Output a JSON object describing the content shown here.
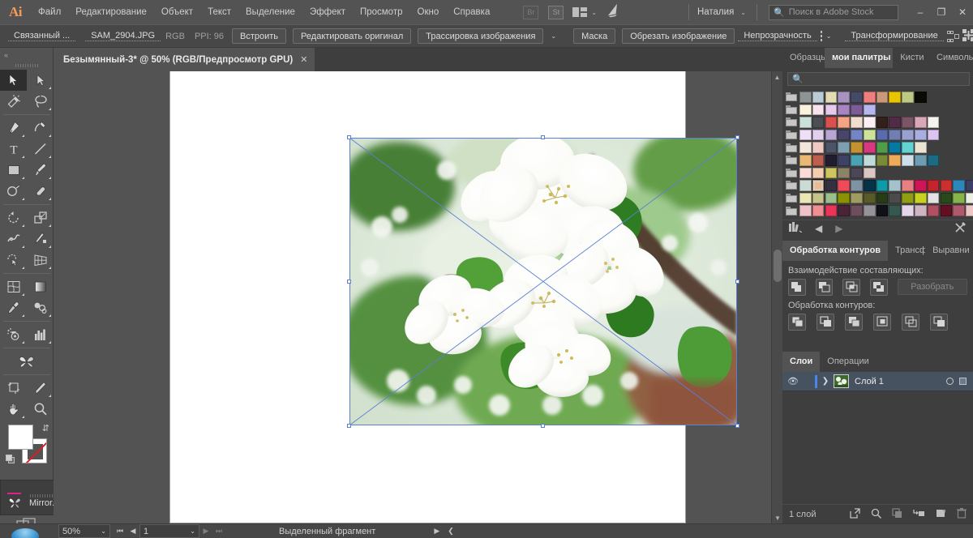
{
  "app": {
    "logo": "Ai",
    "title": "Adobe Illustrator"
  },
  "menu": {
    "items": [
      "Файл",
      "Редактирование",
      "Объект",
      "Текст",
      "Выделение",
      "Эффект",
      "Просмотр",
      "Окно",
      "Справка"
    ],
    "bridge_label": "Br",
    "stock_label": "St",
    "arrange_icon": "arrange-documents-icon",
    "boat_icon": "boat-icon",
    "user_name": "Наталия",
    "search_placeholder": "Поиск в Adobe Stock",
    "search_icon": "search-icon",
    "minimize": "–",
    "restore": "❐",
    "close": "✕"
  },
  "control_bar": {
    "link_status": "Связанный ...",
    "file_name": "SAM_2904.JPG",
    "color_mode": "RGB",
    "ppi": "PPI: 96",
    "embed": "Встроить",
    "edit_original": "Редактировать оригинал",
    "image_trace": "Трассировка изображения",
    "mask": "Маска",
    "crop_image": "Обрезать изображение",
    "opacity": "Непрозрачность",
    "transform": "Трансформирование",
    "align_icon": "align-icon",
    "distribute_icon": "distribute-icon",
    "menu_icon": "panel-menu-icon"
  },
  "document": {
    "tab_title": "Безымянный-3* @ 50% (RGB/Предпросмотр GPU)",
    "close_icon": "close-icon"
  },
  "toolbar": {
    "collapse_icon": "collapse-panel-icon",
    "tools": [
      {
        "name": "selection-tool",
        "selected": true
      },
      {
        "name": "direct-selection-tool",
        "selected": false
      },
      {
        "name": "magic-wand-tool",
        "selected": false
      },
      {
        "name": "lasso-tool",
        "selected": false
      },
      {
        "name": "pen-tool",
        "selected": false
      },
      {
        "name": "curvature-tool",
        "selected": false
      },
      {
        "name": "type-tool",
        "selected": false
      },
      {
        "name": "line-segment-tool",
        "selected": false
      },
      {
        "name": "rectangle-tool",
        "selected": false
      },
      {
        "name": "paintbrush-tool",
        "selected": false
      },
      {
        "name": "shaper-tool",
        "selected": false
      },
      {
        "name": "eraser-tool",
        "selected": false
      },
      {
        "name": "rotate-tool",
        "selected": false
      },
      {
        "name": "scale-tool",
        "selected": false
      },
      {
        "name": "width-tool",
        "selected": false
      },
      {
        "name": "free-transform-tool",
        "selected": false
      },
      {
        "name": "shape-builder-tool",
        "selected": false
      },
      {
        "name": "perspective-grid-tool",
        "selected": false
      },
      {
        "name": "mesh-tool",
        "selected": false
      },
      {
        "name": "gradient-tool",
        "selected": false
      },
      {
        "name": "eyedropper-tool",
        "selected": false
      },
      {
        "name": "blend-tool",
        "selected": false
      },
      {
        "name": "symbol-sprayer-tool",
        "selected": false
      },
      {
        "name": "column-graph-tool",
        "selected": false
      },
      {
        "name": "artboard-tool",
        "selected": false
      },
      {
        "name": "slice-tool",
        "selected": false
      },
      {
        "name": "hand-tool",
        "selected": false
      },
      {
        "name": "zoom-tool",
        "selected": false
      }
    ],
    "fill_color": "#ffffff",
    "stroke_color": "#ffffff",
    "stroke_none": true,
    "swap_icon": "swap-fill-stroke-icon",
    "default_colors_icon": "default-fill-stroke-icon",
    "paint_modes": [
      "color-mode",
      "gradient-mode",
      "none-mode"
    ],
    "draw_modes": [
      "draw-normal",
      "draw-behind",
      "draw-inside"
    ],
    "screen_mode_icon": "change-screen-mode-icon"
  },
  "left_panel": {
    "collapse": "»",
    "close": "✕",
    "brush_icon": "butterfly-brush-icon",
    "label": "Mirror..."
  },
  "canvas": {
    "artboard_background": "#ffffff",
    "selection_color": "#5b7fd4",
    "placed_image_name": "apple-blossom-photo",
    "scroll_up_icon": "scroll-up-icon",
    "scroll_down_icon": "scroll-down-icon"
  },
  "swatches_panel": {
    "tabs": [
      {
        "label": "Образцы",
        "active": false
      },
      {
        "label": "мои палитры",
        "active": true
      },
      {
        "label": "Кисти",
        "active": false
      },
      {
        "label": "Символы",
        "active": false
      }
    ],
    "search_placeholder": "",
    "search_icon": "search-icon",
    "rows": [
      [
        "#8e9493",
        "#b9ccd6",
        "#e3dbb4",
        "#a892c1",
        "#474a66",
        "#ef7f7f",
        "#cb9879",
        "#e8c500",
        "#c0c984",
        "#0a0c04"
      ],
      [
        "#fbf2dd",
        "#f7e2ee",
        "#e6c9ec",
        "#a884c2",
        "#7b5c95",
        "#b7b7ef"
      ],
      [
        "#cbe0d8",
        "#4d4d55",
        "#d9504f",
        "#f4a383",
        "#f0ddcd",
        "#fdeef3",
        "#32201a",
        "#512a45",
        "#7b5566",
        "#d9a7b7",
        "#f5f3ee"
      ],
      [
        "#efe0f8",
        "#e2d0ef",
        "#b9a5d5",
        "#47456a",
        "#7385c4",
        "#cde39a",
        "#5a6cb0",
        "#707eb3",
        "#9aa0cf",
        "#a8aede",
        "#dcc4f0"
      ],
      [
        "#f2e6dd",
        "#f0c8c4",
        "#4b5567",
        "#7d9fb0",
        "#c2932f",
        "#d6397f",
        "#4f9d48",
        "#0579a2",
        "#63d3d2",
        "#ece4d2"
      ],
      [
        "#eab775",
        "#bd5e4f",
        "#221c2f",
        "#3e4165",
        "#49a3b2",
        "#c0dcd8",
        "#7a8b37",
        "#f0ab5a",
        "#cfdfe9",
        "#6e9db3",
        "#1c6a83"
      ],
      [
        "#fbdbd8",
        "#f4cdb0",
        "#cdc560",
        "#8c8268",
        "#4c4657",
        "#d8c7c2"
      ],
      [
        "#ccdcd5",
        "#edbb8a",
        "#34303f",
        "#ec4b57",
        "#8093a5",
        "#053449",
        "#0f9aa8",
        "#a5c1cb",
        "#e87f81",
        "#cf1457",
        "#c4242c",
        "#c9302f",
        "#2c87bb",
        "#3d3d66"
      ],
      [
        "#ebe7b5",
        "#c6c48a",
        "#9bbf8c",
        "#8b9200",
        "#9d9c63",
        "#585a28",
        "#263c17",
        "#4b4b4b",
        "#919e13",
        "#c8d120",
        "#e3e3e3",
        "#2a4919",
        "#86b44a",
        "#e9efe3",
        "#dcdfc1",
        "#f0ef96"
      ],
      [
        "#eec2c8",
        "#ef8e93",
        "#ec3458",
        "#4a2337",
        "#6d4e5c",
        "#96929a",
        "#0e1118",
        "#34584f",
        "#e7d5ea",
        "#cfb4c1",
        "#b14f63",
        "#640e23",
        "#b0596c",
        "#eec6c3",
        "#fae6cb",
        "#c8d9e3"
      ]
    ],
    "footer_icons": [
      "swatch-libraries-icon",
      "previous-swatch-icon",
      "next-swatch-icon",
      "delete-swatch-icon"
    ]
  },
  "pathfinder_panel": {
    "tabs": [
      {
        "label": "Обработка контуров",
        "active": true
      },
      {
        "label": "Трансформ",
        "active": false
      },
      {
        "label": "Выравнивание",
        "active": false
      }
    ],
    "shape_modes_label": "Взаимодействие составляющих:",
    "shape_modes": [
      "unite-icon",
      "minus-front-icon",
      "intersect-icon",
      "exclude-icon"
    ],
    "expand_label": "Разобрать",
    "pathfinders_label": "Обработка контуров:",
    "pathfinders": [
      "divide-icon",
      "trim-icon",
      "merge-icon",
      "crop-icon",
      "outline-icon",
      "minus-back-icon"
    ]
  },
  "layers_panel": {
    "tabs": [
      {
        "label": "Слои",
        "active": true
      },
      {
        "label": "Операции",
        "active": false
      }
    ],
    "rows": [
      {
        "name": "Слой 1",
        "visible": true,
        "expand_icon": "expand-arrow-icon",
        "thumbnail": "layer-thumbnail",
        "target_icon": "target-circle-icon",
        "selection_icon": "selection-square-icon"
      }
    ],
    "footer_count": "1 слой",
    "footer_icons": [
      "locate-object-icon",
      "make-clipping-mask-icon",
      "create-sublayer-icon",
      "create-new-layer-icon",
      "delete-selection-icon"
    ]
  },
  "status_bar": {
    "zoom": "50%",
    "zoom_caret": "⌄",
    "first_icon": "first-artboard-icon",
    "prev_icon": "previous-artboard-icon",
    "page": "1",
    "page_caret": "⌄",
    "next_icon": "next-artboard-icon",
    "last_icon": "last-artboard-icon",
    "status_text": "Выделенный фрагмент",
    "play_icon": "status-menu-icon",
    "back_icon": "status-back-icon"
  }
}
